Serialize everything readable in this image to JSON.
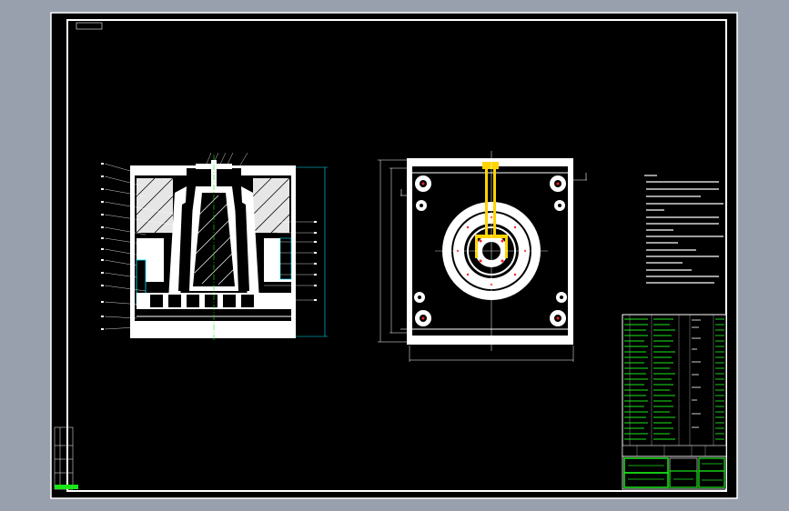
{
  "drawing": {
    "corner_tag": "",
    "section_label": "",
    "views": [
      "section-view",
      "top-view"
    ],
    "technical_notes": {
      "heading": "",
      "lines": []
    },
    "title_block": {
      "drawing_name": "",
      "drawing_number": ""
    },
    "colors": {
      "background": "#98a0ad",
      "sheet": "#000000",
      "frame": "#ffffff",
      "dimension": "#00e5ff",
      "title_block": "#1ae61a",
      "sprue": "#ffd400",
      "center_mark": "#ff2020"
    }
  }
}
